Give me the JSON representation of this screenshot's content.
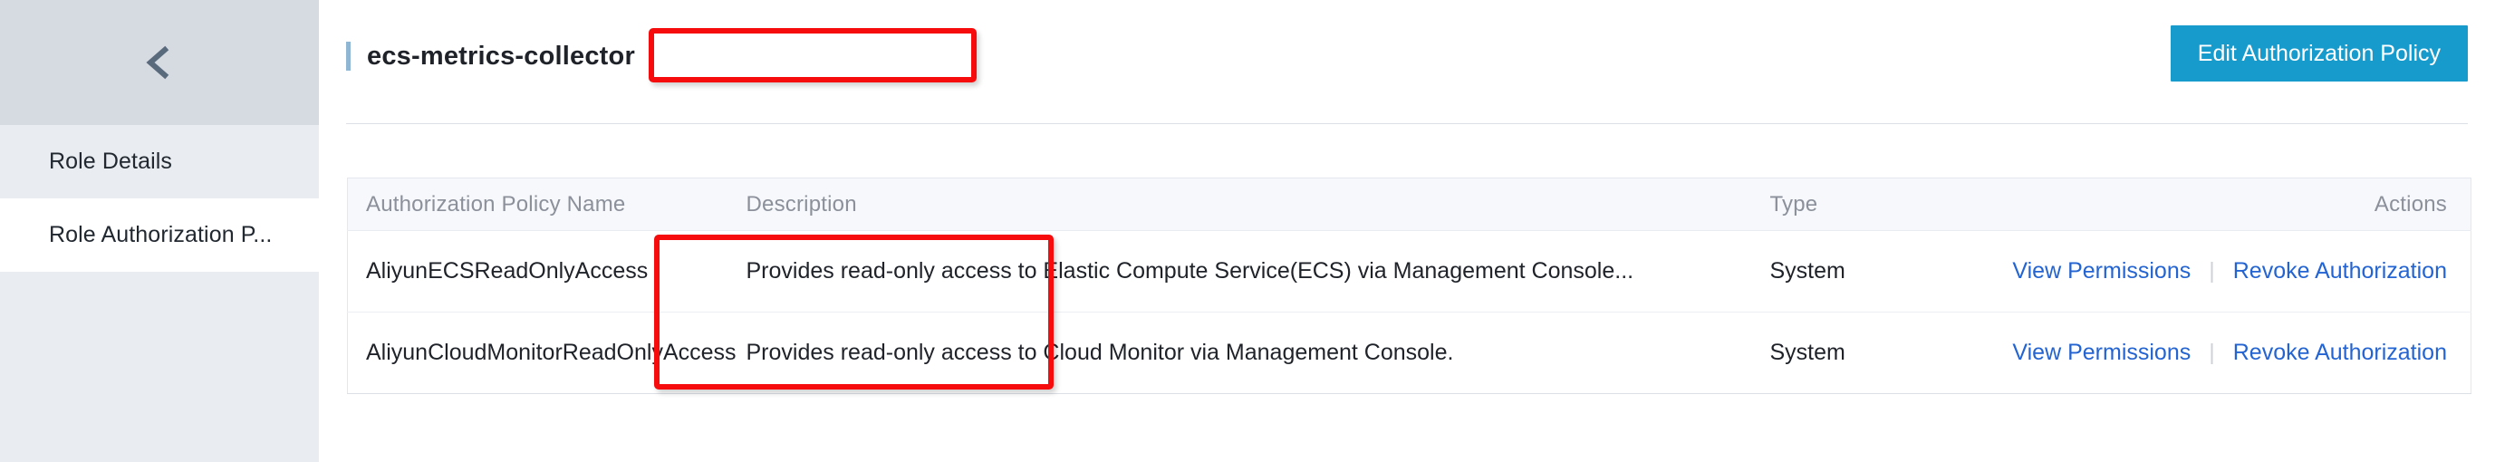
{
  "sidebar": {
    "collapse_icon": "chevron-left-icon",
    "items": [
      {
        "label": "Role Details",
        "active": true
      },
      {
        "label": "Role Authorization P...",
        "active": false
      }
    ]
  },
  "header": {
    "title": "ecs-metrics-collector",
    "accent_color": "#8fb7d4",
    "primary_button": {
      "label": "Edit Authorization Policy",
      "color": "#179bcc"
    }
  },
  "table": {
    "columns": [
      "Authorization Policy Name",
      "Description",
      "Type",
      "Actions"
    ],
    "rows": [
      {
        "name": "AliyunECSReadOnlyAccess",
        "description": "Provides read-only access to Elastic Compute Service(ECS) via Management Console...",
        "type": "System",
        "actions": {
          "view": "View Permissions",
          "separator": "|",
          "revoke": "Revoke Authorization"
        }
      },
      {
        "name": "AliyunCloudMonitorReadOnlyAccess",
        "description": "Provides read-only access to Cloud Monitor via Management Console.",
        "type": "System",
        "actions": {
          "view": "View Permissions",
          "separator": "|",
          "revoke": "Revoke Authorization"
        }
      }
    ],
    "link_color": "#2364d2"
  },
  "annotations": {
    "color": "#f60c0c",
    "boxes": [
      {
        "target": "page-title"
      },
      {
        "target": "policy-name-column-cells"
      }
    ]
  }
}
